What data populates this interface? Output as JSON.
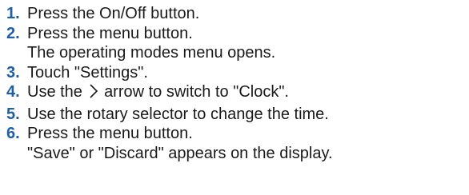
{
  "steps": [
    {
      "number": "1.",
      "lines": [
        "Press the On/Off button."
      ]
    },
    {
      "number": "2.",
      "lines": [
        "Press the menu button.",
        "The operating modes menu opens."
      ]
    },
    {
      "number": "3.",
      "lines": [
        "Touch \"Settings\"."
      ]
    },
    {
      "number": "4.",
      "before_icon": "Use the",
      "icon": "chevron-right-icon",
      "after_icon": "arrow to switch to \"Clock\"."
    },
    {
      "number": "5.",
      "lines": [
        "Use the rotary selector to change the time."
      ]
    },
    {
      "number": "6.",
      "lines": [
        "Press the menu button.",
        "\"Save\" or \"Discard\" appears on the display."
      ]
    }
  ],
  "colors": {
    "step_number": "#1f5fa8",
    "text": "#1a1a1a",
    "background": "#ffffff"
  }
}
